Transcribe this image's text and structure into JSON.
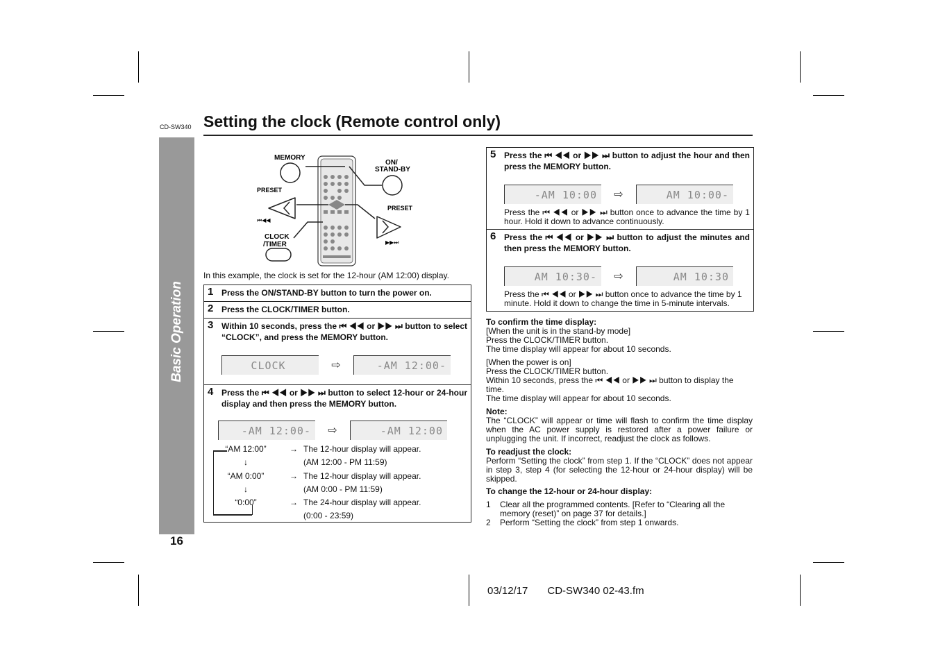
{
  "header": {
    "model": "CD-SW340",
    "title": "Setting the clock (Remote control only)"
  },
  "side_tab": {
    "label": "Basic Operation"
  },
  "page_number": "16",
  "illustration": {
    "labels": {
      "memory": "MEMORY",
      "on_standby_1": "ON/",
      "on_standby_2": "STAND-BY",
      "preset_left": "PRESET",
      "preset_right": "PRESET",
      "clock_1": "CLOCK",
      "clock_2": "/TIMER",
      "prev_symbols": "⏮◀◀",
      "next_symbols": "▶▶⏭"
    }
  },
  "intro": "In this example, the clock is set for the 12-hour (AM 12:00) display.",
  "steps": [
    {
      "num": "1",
      "text": "Press the ON/STAND-BY button to turn the power on."
    },
    {
      "num": "2",
      "text": "Press the CLOCK/TIMER button."
    },
    {
      "num": "3",
      "text": "Within 10 seconds, press the ⏮ ◀◀ or ▶▶ ⏭ button to select “CLOCK”, and press the MEMORY button.",
      "display_from": "CLOCK",
      "display_to": "-AM 12:00-"
    },
    {
      "num": "4",
      "text": "Press the ⏮ ◀◀ or ▶▶ ⏭ button to select 12-hour or 24-hour display and then press the MEMORY button.",
      "display_from": "-AM 12:00-",
      "display_to": "-AM 12:00",
      "cycle": [
        {
          "value": "“AM 12:00”",
          "arrow": "→",
          "desc": "The 12-hour display will appear.",
          "range": "(AM 12:00 - PM 11:59)"
        },
        {
          "value": "“AM 0:00”",
          "arrow": "→",
          "desc": "The 12-hour display will appear.",
          "range": "(AM 0:00 - PM 11:59)"
        },
        {
          "value": "“0:00”",
          "arrow": "→",
          "desc": "The 24-hour display will appear.",
          "range": "(0:00 - 23:59)"
        }
      ]
    },
    {
      "num": "5",
      "text": "Press the ⏮ ◀◀ or ▶▶ ⏭ button to adjust the hour and then press the MEMORY button.",
      "display_from": "-AM 10:00",
      "display_to": "AM 10:00-",
      "note": "Press the ⏮ ◀◀ or ▶▶ ⏭ button once to advance the time by 1 hour. Hold it down to advance continuously."
    },
    {
      "num": "6",
      "text": "Press the ⏮ ◀◀ or ▶▶ ⏭ button to adjust the minutes and then press the MEMORY button.",
      "display_from": "AM 10:30-",
      "display_to": "AM 10:30",
      "note": "Press the ⏮ ◀◀ or ▶▶ ⏭ button once to advance the time by 1 minute. Hold it down to change the time in 5-minute intervals."
    }
  ],
  "arrow_symbol": "⇨",
  "confirm": {
    "heading": "To confirm the time display:",
    "standby_cond": "[When the unit is in the stand-by mode]",
    "standby_l1": "Press the CLOCK/TIMER button.",
    "standby_l2": "The time display will appear for about 10 seconds.",
    "on_cond": "[When the power is on]",
    "on_l1": "Press the CLOCK/TIMER button.",
    "on_l2": "Within 10 seconds, press the ⏮ ◀◀ or ▶▶ ⏭ button to display the time.",
    "on_l3": "The time display will appear for about 10 seconds."
  },
  "note": {
    "heading": "Note:",
    "text": "The “CLOCK” will appear or time will flash to confirm the time display when the AC power supply is restored after a power failure or unplugging the unit. If incorrect, readjust the clock as follows."
  },
  "readjust": {
    "heading": "To readjust the clock:",
    "text": "Perform “Setting the clock” from step 1. If the “CLOCK” does not appear in step 3, step 4 (for selecting the 12-hour or 24-hour display) will be skipped."
  },
  "change": {
    "heading": "To change the 12-hour or 24-hour display:",
    "items": [
      {
        "n": "1",
        "text": "Clear all the programmed contents. [Refer to “Clearing all the memory (reset)” on page 37 for details.]"
      },
      {
        "n": "2",
        "text": "Perform “Setting the clock” from step 1 onwards."
      }
    ]
  },
  "footer": {
    "date": "03/12/17",
    "file": "CD-SW340 02-43.fm"
  }
}
